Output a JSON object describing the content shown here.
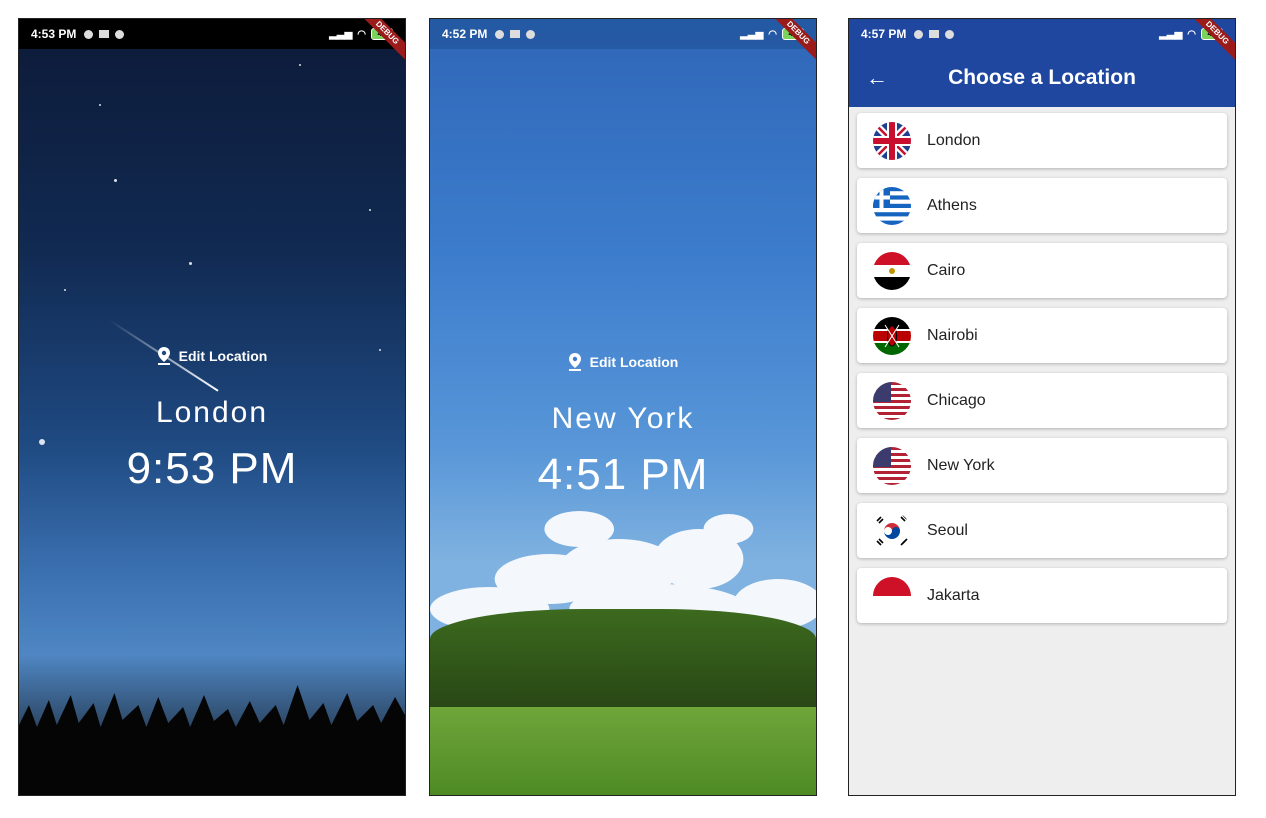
{
  "screens": [
    {
      "status_time": "4:53 PM",
      "battery": "49",
      "debug_label": "DEBUG",
      "edit_label": "Edit Location",
      "city": "London",
      "time": "9:53 PM"
    },
    {
      "status_time": "4:52 PM",
      "battery": "49",
      "debug_label": "DEBUG",
      "edit_label": "Edit Location",
      "city": "New York",
      "time": "4:51 PM"
    }
  ],
  "locations_screen": {
    "status_time": "4:57 PM",
    "battery": "49",
    "debug_label": "DEBUG",
    "title": "Choose a Location",
    "back_icon": "arrow-back-icon",
    "items": [
      {
        "name": "London",
        "flag": "uk-flag-icon"
      },
      {
        "name": "Athens",
        "flag": "greece-flag-icon"
      },
      {
        "name": "Cairo",
        "flag": "egypt-flag-icon"
      },
      {
        "name": "Nairobi",
        "flag": "kenya-flag-icon"
      },
      {
        "name": "Chicago",
        "flag": "usa-flag-icon"
      },
      {
        "name": "New York",
        "flag": "usa-flag-icon"
      },
      {
        "name": "Seoul",
        "flag": "south-korea-flag-icon"
      },
      {
        "name": "Jakarta",
        "flag": "indonesia-flag-icon"
      }
    ]
  },
  "colors": {
    "app_bar": "#1f47a0",
    "list_background": "#eeeeee",
    "debug_banner": "#9b1b1b"
  }
}
